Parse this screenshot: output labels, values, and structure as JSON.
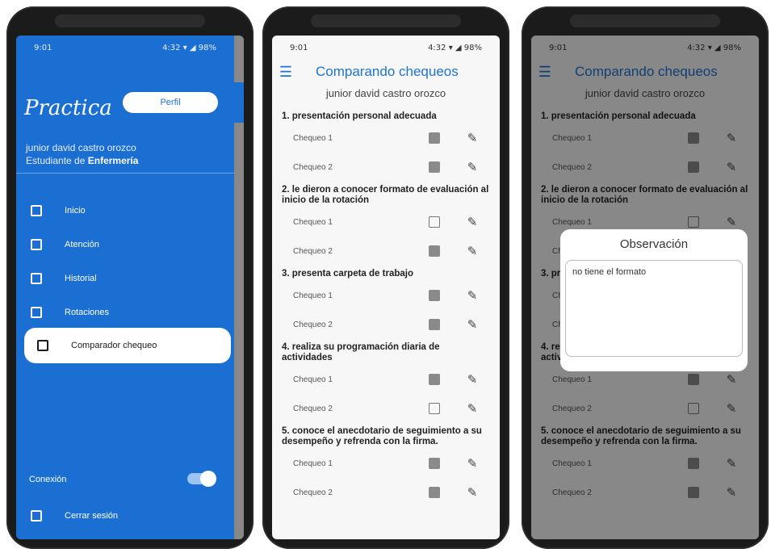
{
  "status": {
    "time": "9:01",
    "right": "4:32 ▾ ◢ 98%"
  },
  "drawer": {
    "logo_text": "Practica",
    "profile_button": "Perfil",
    "close_glyph": "✕",
    "user_name": "junior david castro orozco",
    "user_role_prefix": "Estudiante de ",
    "user_role_program": "Enfermería",
    "items": [
      {
        "label": "Inicio",
        "icon": "home-icon"
      },
      {
        "label": "Atención",
        "icon": "save-icon"
      },
      {
        "label": "Historial",
        "icon": "calendar-icon"
      },
      {
        "label": "Rotaciones",
        "icon": "rotation-icon"
      },
      {
        "label": "Comparador chequeo",
        "icon": "compare-icon"
      }
    ],
    "connection_label": "Conexión",
    "connection_on": true,
    "logout_label": "Cerrar sesión"
  },
  "screen": {
    "title": "Comparando chequeos",
    "subtitle": "junior david castro orozco",
    "chequeo1": "Chequeo 1",
    "chequeo2": "Chequeo 2",
    "questions": [
      {
        "text": "1. presentación personal adecuada",
        "c1": true,
        "c2": true
      },
      {
        "text": "2. le dieron a conocer formato de evaluación al inicio de la rotación",
        "c1": false,
        "c2": true
      },
      {
        "text": "3. presenta carpeta de trabajo",
        "c1": true,
        "c2": true
      },
      {
        "text": "4. realiza su programación diaria de actividades",
        "c1": true,
        "c2": false
      },
      {
        "text": "5. conoce el anecdotario de seguimiento a su desempeño y refrenda con la firma.",
        "c1": true,
        "c2": true
      }
    ]
  },
  "dialog": {
    "title": "Observación",
    "text": "no tiene el formato"
  }
}
